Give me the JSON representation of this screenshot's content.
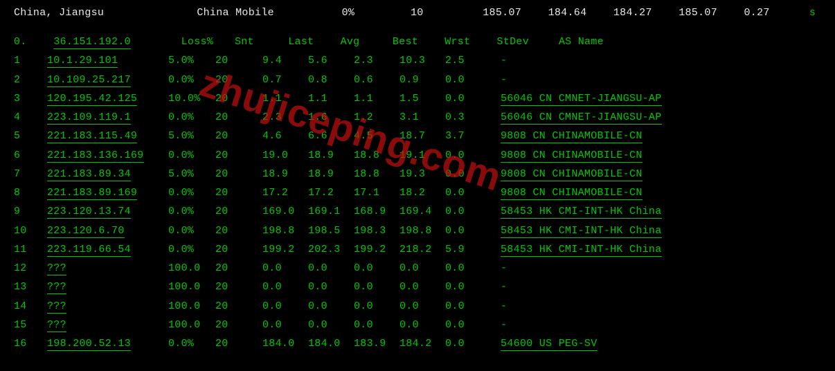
{
  "top": {
    "location": "China, Jiangsu",
    "isp": "China Mobile",
    "loss": "0%",
    "snt": "10",
    "v1": "185.07",
    "v2": "184.64",
    "v3": "184.27",
    "v4": "185.07",
    "v5": "0.27",
    "trail": "s"
  },
  "headers": {
    "idx": "0.",
    "host": "36.151.192.0",
    "loss": "Loss%",
    "snt": "Snt",
    "last": "Last",
    "avg": "Avg",
    "best": "Best",
    "wrst": "Wrst",
    "stdev": "StDev",
    "as": "AS Name"
  },
  "hops": [
    {
      "idx": "1",
      "host": "10.1.29.101",
      "loss": "5.0%",
      "snt": "20",
      "last": "9.4",
      "avg": "5.6",
      "best": "2.3",
      "wrst": "10.3",
      "stdev": "2.5",
      "as": "-",
      "asul": false
    },
    {
      "idx": "2",
      "host": "10.109.25.217",
      "loss": "0.0%",
      "snt": "20",
      "last": "0.7",
      "avg": "0.8",
      "best": "0.6",
      "wrst": "0.9",
      "stdev": "0.0",
      "as": "-",
      "asul": false
    },
    {
      "idx": "3",
      "host": "120.195.42.125",
      "loss": "10.0%",
      "snt": "20",
      "last": "1.1",
      "avg": "1.1",
      "best": "1.1",
      "wrst": "1.5",
      "stdev": "0.0",
      "as": "56046 CN CMNET-JIANGSU-AP",
      "asul": true
    },
    {
      "idx": "4",
      "host": "223.109.119.1",
      "loss": "0.0%",
      "snt": "20",
      "last": "2.3",
      "avg": "1.6",
      "best": "1.2",
      "wrst": "3.1",
      "stdev": "0.3",
      "as": "56046 CN CMNET-JIANGSU-AP",
      "asul": true
    },
    {
      "idx": "5",
      "host": "221.183.115.49",
      "loss": "5.0%",
      "snt": "20",
      "last": "4.6",
      "avg": "6.6",
      "best": "4.5",
      "wrst": "18.7",
      "stdev": "3.7",
      "as": "9808  CN CHINAMOBILE-CN",
      "asul": true
    },
    {
      "idx": "6",
      "host": "221.183.136.169",
      "loss": "0.0%",
      "snt": "20",
      "last": "19.0",
      "avg": "18.9",
      "best": "18.8",
      "wrst": "19.1",
      "stdev": "0.0",
      "as": "9808  CN CHINAMOBILE-CN",
      "asul": true
    },
    {
      "idx": "7",
      "host": "221.183.89.34",
      "loss": "5.0%",
      "snt": "20",
      "last": "18.9",
      "avg": "18.9",
      "best": "18.8",
      "wrst": "19.3",
      "stdev": "0.0",
      "as": "9808  CN CHINAMOBILE-CN",
      "asul": true
    },
    {
      "idx": "8",
      "host": "221.183.89.169",
      "loss": "0.0%",
      "snt": "20",
      "last": "17.2",
      "avg": "17.2",
      "best": "17.1",
      "wrst": "18.2",
      "stdev": "0.0",
      "as": "9808  CN CHINAMOBILE-CN",
      "asul": true
    },
    {
      "idx": "9",
      "host": "223.120.13.74",
      "loss": "0.0%",
      "snt": "20",
      "last": "169.0",
      "avg": "169.1",
      "best": "168.9",
      "wrst": "169.4",
      "stdev": "0.0",
      "as": "58453 HK CMI-INT-HK China",
      "asul": true
    },
    {
      "idx": "10",
      "host": "223.120.6.70",
      "loss": "0.0%",
      "snt": "20",
      "last": "198.8",
      "avg": "198.5",
      "best": "198.3",
      "wrst": "198.8",
      "stdev": "0.0",
      "as": "58453 HK CMI-INT-HK China",
      "asul": true
    },
    {
      "idx": "11",
      "host": "223.119.66.54",
      "loss": "0.0%",
      "snt": "20",
      "last": "199.2",
      "avg": "202.3",
      "best": "199.2",
      "wrst": "218.2",
      "stdev": "5.9",
      "as": "58453 HK CMI-INT-HK China",
      "asul": true
    },
    {
      "idx": "12",
      "host": "???",
      "loss": "100.0",
      "snt": "20",
      "last": "0.0",
      "avg": "0.0",
      "best": "0.0",
      "wrst": "0.0",
      "stdev": "0.0",
      "as": "-",
      "asul": false
    },
    {
      "idx": "13",
      "host": "???",
      "loss": "100.0",
      "snt": "20",
      "last": "0.0",
      "avg": "0.0",
      "best": "0.0",
      "wrst": "0.0",
      "stdev": "0.0",
      "as": "-",
      "asul": false
    },
    {
      "idx": "14",
      "host": "???",
      "loss": "100.0",
      "snt": "20",
      "last": "0.0",
      "avg": "0.0",
      "best": "0.0",
      "wrst": "0.0",
      "stdev": "0.0",
      "as": "-",
      "asul": false
    },
    {
      "idx": "15",
      "host": "???",
      "loss": "100.0",
      "snt": "20",
      "last": "0.0",
      "avg": "0.0",
      "best": "0.0",
      "wrst": "0.0",
      "stdev": "0.0",
      "as": "-",
      "asul": false
    },
    {
      "idx": "16",
      "host": "198.200.52.13",
      "loss": "0.0%",
      "snt": "20",
      "last": "184.0",
      "avg": "184.0",
      "best": "183.9",
      "wrst": "184.2",
      "stdev": "0.0",
      "as": "54600 US PEG-SV",
      "asul": true
    }
  ],
  "watermark": "zhujiceping.com"
}
